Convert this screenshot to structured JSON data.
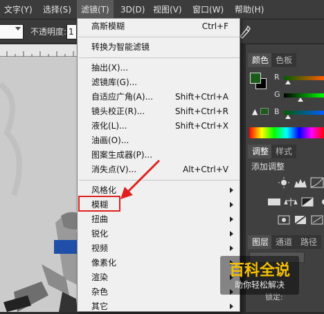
{
  "menubar": {
    "items": [
      {
        "label": "文字(Y)"
      },
      {
        "label": "选择(S)"
      },
      {
        "label": "滤镜(T)"
      },
      {
        "label": "3D(D)"
      },
      {
        "label": "视图(V)"
      },
      {
        "label": "窗口(W)"
      },
      {
        "label": "帮助(H)"
      }
    ],
    "active": "滤镜(T)"
  },
  "options_bar": {
    "opacity_label": "不透明度:",
    "opacity_value": "1"
  },
  "filter_menu": {
    "items": [
      {
        "label": "高斯模糊",
        "shortcut": "Ctrl+F"
      },
      {
        "label": "转换为智能滤镜",
        "shortcut": ""
      },
      {
        "label": "抽出(X)...",
        "shortcut": ""
      },
      {
        "label": "滤镜库(G)...",
        "shortcut": ""
      },
      {
        "label": "自适应广角(A)...",
        "shortcut": "Shift+Ctrl+A"
      },
      {
        "label": "镜头校正(R)...",
        "shortcut": "Shift+Ctrl+R"
      },
      {
        "label": "液化(L)...",
        "shortcut": "Shift+Ctrl+X"
      },
      {
        "label": "油画(O)...",
        "shortcut": ""
      },
      {
        "label": "图案生成器(P)...",
        "shortcut": ""
      },
      {
        "label": "消失点(V)...",
        "shortcut": "Alt+Ctrl+V"
      },
      {
        "label": "风格化",
        "submenu": true
      },
      {
        "label": "模糊",
        "submenu": true,
        "highlighted": true
      },
      {
        "label": "扭曲",
        "submenu": true
      },
      {
        "label": "锐化",
        "submenu": true
      },
      {
        "label": "视频",
        "submenu": true
      },
      {
        "label": "像素化",
        "submenu": true
      },
      {
        "label": "渲染",
        "submenu": true
      },
      {
        "label": "杂色",
        "submenu": true
      },
      {
        "label": "其它",
        "submenu": true
      }
    ]
  },
  "color_panel": {
    "tabs": [
      "颜色",
      "色板"
    ],
    "channels": [
      "R",
      "G",
      "B"
    ],
    "foreground": "#1a5c1a",
    "background": "#000000"
  },
  "adjust_panel": {
    "tabs": [
      "调整",
      "样式"
    ],
    "title": "添加调整"
  },
  "layers_panel": {
    "tabs": [
      "图层",
      "通道",
      "路径"
    ],
    "lock_label": "锁定:"
  },
  "watermark": {
    "brand": "百科全说",
    "subtitle": "助你轻松解决"
  },
  "colors": {
    "highlight_box": "#e01f1f",
    "annotation_arrow": "#e01f1f",
    "menu_bg": "#f0f0f0"
  }
}
